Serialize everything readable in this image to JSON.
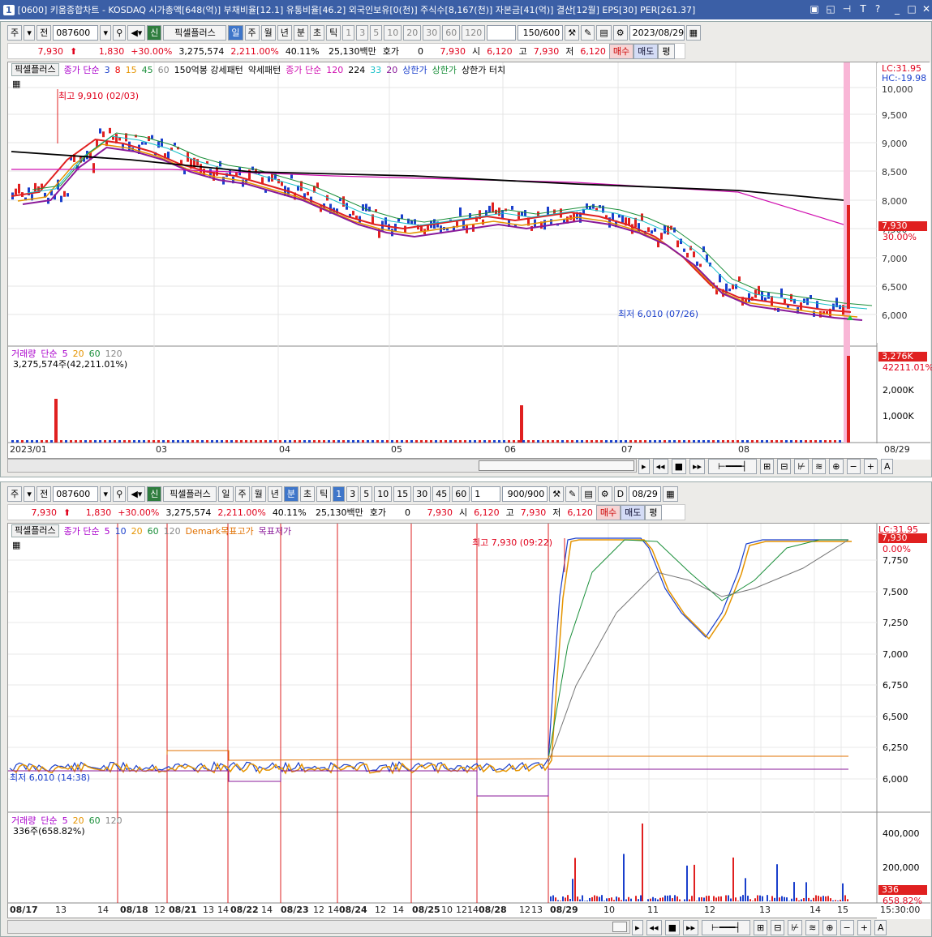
{
  "window": {
    "num": "1",
    "title": "[0600] 키움종합차트 - KOSDAQ 시가총액[648(억)] 부채비율[12.1] 유통비율[46.2] 외국인보유[0(천)] 주식수[8,167(천)] 자본금[41(억)] 결산[12월] EPS[30] PER[261.37]",
    "sys": [
      "▣",
      "◱",
      "⊣",
      "T",
      "?",
      "_",
      "□",
      "✕"
    ]
  },
  "top": {
    "toolbar": {
      "type1": "주",
      "type2": "전",
      "code": "087600",
      "periods": [
        "일",
        "주",
        "월",
        "년",
        "분",
        "초",
        "틱"
      ],
      "mins": [
        "1",
        "3",
        "5",
        "10",
        "20",
        "30",
        "60",
        "120"
      ],
      "count": "150/600",
      "date": "2023/08/29",
      "pixel": "신",
      "pixel_label": "픽셀플러스"
    },
    "quote": {
      "price": "7,930",
      "arrow": "⬆",
      "change": "1,830",
      "pct": "+30.00%",
      "volume": "3,275,574",
      "vol_pct": "2,211.00%",
      "turnover": "40.11%",
      "amount": "25,130백만",
      "hoga_label": "호가",
      "hoga": "0",
      "p2": "7,930",
      "open_l": "시",
      "open": "6,120",
      "high_l": "고",
      "high": "7,930",
      "low_l": "저",
      "low": "6,120",
      "buy": "매수",
      "sell": "매도",
      "avg": "평"
    },
    "legend": {
      "name": "픽셀플러스",
      "ma": "종가 단순",
      "ma_vals": [
        "3",
        "8",
        "15",
        "45",
        "60"
      ],
      "pattern": "150억봉 강세패턴",
      "weak": "약세패턴",
      "ma2": "종가 단순",
      "ma2_vals": [
        "120",
        "224",
        "33",
        "20"
      ],
      "up": "상한가",
      "up2": "상한가",
      "uptouch": "상한가 터치"
    },
    "lc": "LC:31.95",
    "hc": "HC:-19.98",
    "yticks": [
      "10,000",
      "9,500",
      "9,000",
      "8,500",
      "8,000",
      "7,500",
      "7,000",
      "6,500",
      "6,000"
    ],
    "tag_price": "7,930",
    "tag_pct": "30.00%",
    "max_label": "최고 9,910 (02/03)",
    "min_label": "최저 6,010 (07/26)",
    "vol_legend": {
      "name": "거래량",
      "ma": "단순",
      "vals": [
        "5",
        "20",
        "60",
        "120"
      ],
      "value": "3,275,574주(42,211.01%)"
    },
    "vol_yticks": [
      "2,000K",
      "1,000K"
    ],
    "vol_tag": "3,276K",
    "vol_tag2": "42211.01%",
    "xticks": [
      "2023/01",
      "03",
      "04",
      "05",
      "06",
      "07",
      "08",
      "08/29"
    ]
  },
  "bottom": {
    "toolbar": {
      "type1": "주",
      "type2": "전",
      "code": "087600",
      "periods": [
        "일",
        "주",
        "월",
        "년",
        "분",
        "초",
        "틱"
      ],
      "mins": [
        "1",
        "3",
        "5",
        "10",
        "15",
        "30",
        "45",
        "60"
      ],
      "unit": "1",
      "count": "900/900",
      "chk": "D",
      "date": "08/29",
      "pixel": "신",
      "pixel_label": "픽셀플러스"
    },
    "quote": {
      "price": "7,930",
      "arrow": "⬆",
      "change": "1,830",
      "pct": "+30.00%",
      "volume": "3,275,574",
      "vol_pct": "2,211.00%",
      "turnover": "40.11%",
      "amount": "25,130백만",
      "hoga_label": "호가",
      "hoga": "0",
      "p2": "7,930",
      "open_l": "시",
      "open": "6,120",
      "high_l": "고",
      "high": "7,930",
      "low_l": "저",
      "low": "6,120",
      "buy": "매수",
      "sell": "매도",
      "avg": "평"
    },
    "legend": {
      "name": "픽셀플러스",
      "ma": "종가 단순",
      "ma_vals": [
        "5",
        "10",
        "20",
        "60",
        "120"
      ],
      "demark": "Demark목표고가",
      "demark2": "목표저가"
    },
    "lc": "LC:31.95",
    "yticks": [
      "7,750",
      "7,500",
      "7,250",
      "7,000",
      "6,750",
      "6,500",
      "6,250",
      "6,000"
    ],
    "tag_price": "7,930",
    "tag_pct": "0.00%",
    "max_label": "최고 7,930 (09:22)",
    "min_label": "최저 6,010 (14:38)",
    "vol_legend": {
      "name": "거래량",
      "ma": "단순",
      "vals": [
        "5",
        "20",
        "60",
        "120"
      ],
      "value": "336주(658.82%)"
    },
    "vol_yticks": [
      "400,000",
      "200,000"
    ],
    "vol_tag": "336",
    "vol_tag2": "658.82%",
    "xticks": [
      "08/17",
      "13",
      "14",
      "08/18",
      "12",
      "08/21",
      "13",
      "14",
      "08/22",
      "14",
      "08/23",
      "12",
      "14",
      "08/24",
      "12",
      "14",
      "08/25",
      "10",
      "12",
      "14",
      "08/28",
      "12",
      "13",
      "08/29",
      "10",
      "11",
      "12",
      "13",
      "14",
      "15",
      "15:30:00"
    ]
  }
}
